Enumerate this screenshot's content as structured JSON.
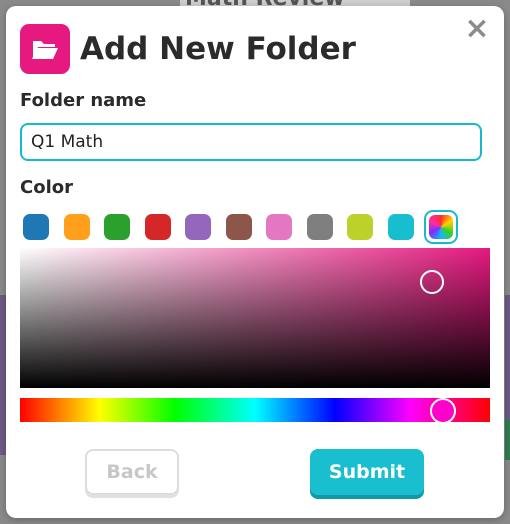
{
  "background": {
    "page_title": "Math Review"
  },
  "modal": {
    "title": "Add New Folder",
    "close_symbol": "×",
    "folder_name_label": "Folder name",
    "folder_name_value": "Q1 Math",
    "color_label": "Color",
    "swatches": [
      {
        "name": "blue",
        "color": "#1f77b4"
      },
      {
        "name": "orange",
        "color": "#ff9f1c"
      },
      {
        "name": "green",
        "color": "#2ca02c"
      },
      {
        "name": "red",
        "color": "#d62728"
      },
      {
        "name": "purple",
        "color": "#9467bd"
      },
      {
        "name": "brown",
        "color": "#8c564b"
      },
      {
        "name": "pink",
        "color": "#e377c2"
      },
      {
        "name": "gray",
        "color": "#7f7f7f"
      },
      {
        "name": "lime",
        "color": "#bcd22a"
      },
      {
        "name": "cyan",
        "color": "#17becf"
      }
    ],
    "custom_swatch_selected": true,
    "picker": {
      "hue_color": "#e5197f",
      "hue_position": 0.9
    },
    "back_label": "Back",
    "submit_label": "Submit",
    "accent_color": "#19bfcf",
    "icon_color": "#e5197f"
  }
}
